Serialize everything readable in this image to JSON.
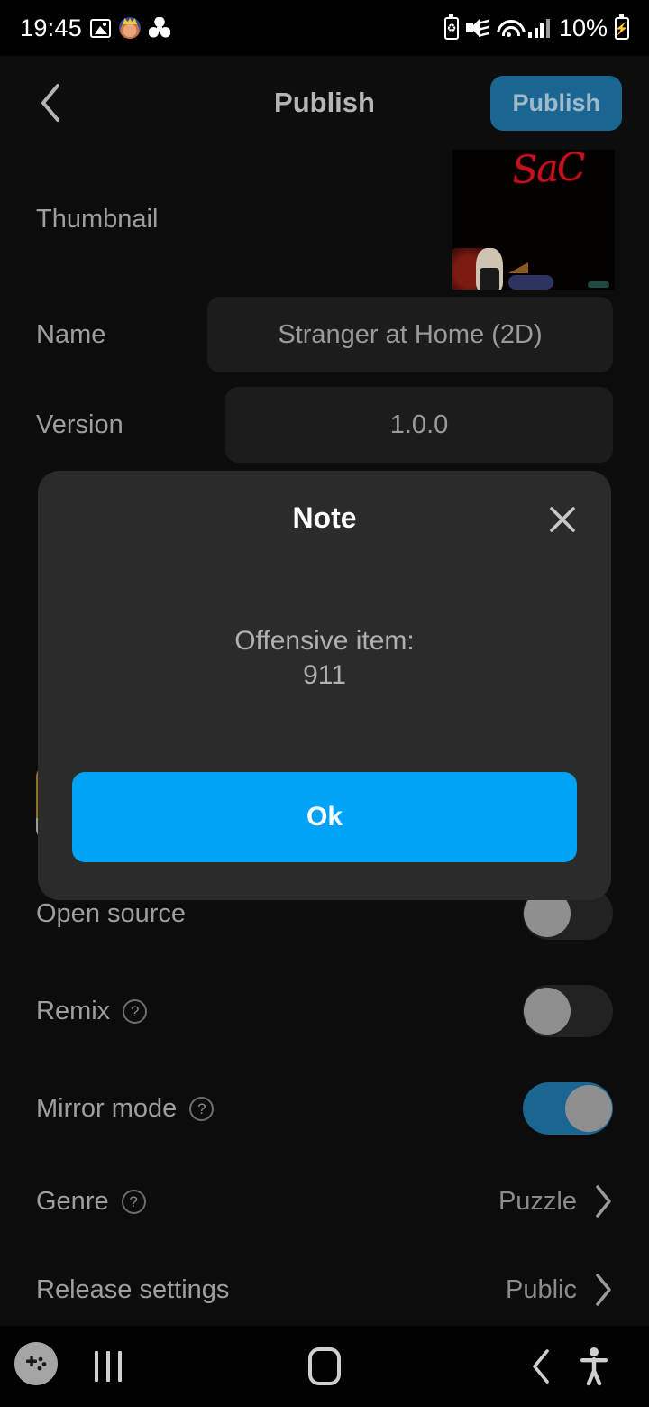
{
  "statusbar": {
    "time": "19:45",
    "battery_percent": "10%",
    "left_icons": [
      "gallery-icon",
      "character-app-icon",
      "fan-icon"
    ],
    "right_icons": [
      "battery-saver-icon",
      "mute-vibrate-icon",
      "wifi-icon",
      "cellular-signal-icon",
      "charging-battery-icon"
    ]
  },
  "appbar": {
    "back_icon": "chevron-left-icon",
    "title": "Publish",
    "publish_button": "Publish",
    "publish_button_color": "#1b6593"
  },
  "form": {
    "thumbnail_label": "Thumbnail",
    "thumbnail_caption": "SaC",
    "name_label": "Name",
    "name_value": "Stranger at Home (2D)",
    "version_label": "Version",
    "version_value": "1.0.0"
  },
  "settings": {
    "open_source_label": "Open source",
    "open_source_on": false,
    "remix_label": "Remix",
    "remix_on": false,
    "mirror_mode_label": "Mirror mode",
    "mirror_mode_on": true,
    "genre_label": "Genre",
    "genre_value": "Puzzle",
    "release_settings_label": "Release settings",
    "release_settings_value": "Public",
    "help_icon": "question-mark-icon",
    "chevron_icon": "chevron-right-icon",
    "toggle_on_color": "#1b6593",
    "toggle_off_color": "#222222"
  },
  "dialog": {
    "title": "Note",
    "close_icon": "close-icon",
    "message_line1": "Offensive item:",
    "message_line2": "911",
    "ok_button": "Ok",
    "ok_button_color": "#00a3f5"
  },
  "sysnav": {
    "gamepad_icon": "gamepad-floating-icon",
    "recents_icon": "recents-icon",
    "home_icon": "home-icon",
    "back_icon": "back-icon",
    "accessibility_icon": "accessibility-icon"
  }
}
